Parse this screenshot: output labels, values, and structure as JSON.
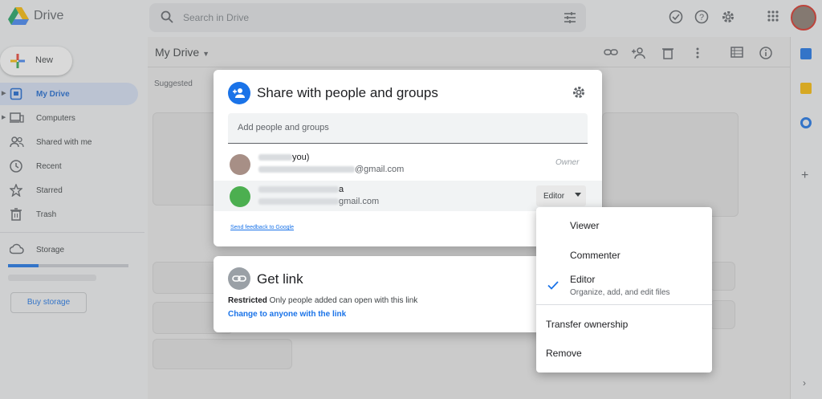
{
  "app": {
    "name": "Drive"
  },
  "search": {
    "placeholder": "Search in Drive"
  },
  "sidebar": {
    "new_label": "New",
    "items": [
      {
        "label": "My Drive",
        "icon": "my-drive-icon",
        "active": true
      },
      {
        "label": "Computers",
        "icon": "computer-icon"
      },
      {
        "label": "Shared with me",
        "icon": "people-icon"
      },
      {
        "label": "Recent",
        "icon": "clock-icon"
      },
      {
        "label": "Starred",
        "icon": "star-icon"
      },
      {
        "label": "Trash",
        "icon": "trash-icon"
      }
    ],
    "storage_label": "Storage",
    "buy_storage_label": "Buy storage"
  },
  "main": {
    "title": "My Drive",
    "suggested_label": "Suggested"
  },
  "share_dialog": {
    "title": "Share with people and groups",
    "add_placeholder": "Add people and groups",
    "people": [
      {
        "name_suffix": "you)",
        "email_suffix": "@gmail.com",
        "role": "Owner"
      },
      {
        "name_suffix": "a",
        "email_suffix": "gmail.com",
        "role": "Editor"
      }
    ],
    "feedback_link": "Send feedback to Google"
  },
  "get_link": {
    "title": "Get link",
    "restricted_bold": "Restricted",
    "restricted_text": " Only people added can open with this link",
    "change_link": "Change to anyone with the link"
  },
  "role_menu": {
    "items": [
      {
        "label": "Viewer",
        "sub": ""
      },
      {
        "label": "Commenter",
        "sub": ""
      },
      {
        "label": "Editor",
        "sub": "Organize, add, and edit files",
        "selected": true
      },
      {
        "label": "Transfer ownership",
        "sub": ""
      },
      {
        "label": "Remove",
        "sub": ""
      }
    ]
  },
  "colors": {
    "accent": "#1a73e8",
    "active_nav_bg": "#d6e1f5"
  }
}
